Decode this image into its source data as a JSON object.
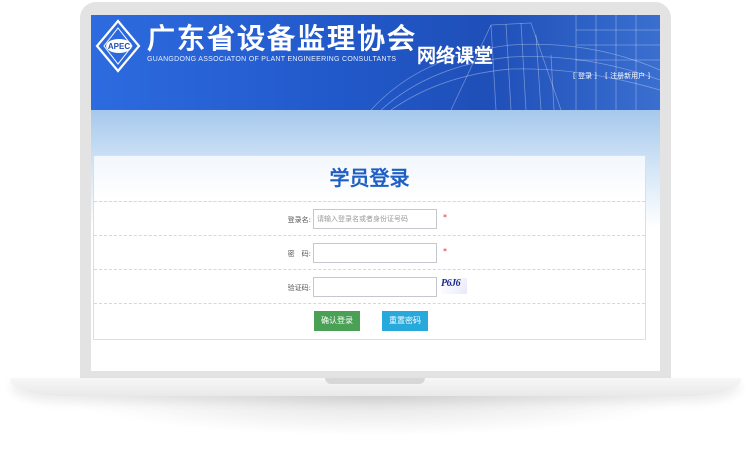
{
  "header": {
    "logo_text": "APEC",
    "org_name_cn": "广东省设备监理协会",
    "org_name_en": "GUANGDONG ASSOCIATON OF PLANT ENGINEERING CONSULTANTS",
    "classroom_label": "网络课堂",
    "links": {
      "login": "[ 登录 ]",
      "register": "[ 注册新用户 ]"
    }
  },
  "login_panel": {
    "title": "学员登录",
    "username": {
      "label": "登录名:",
      "placeholder": "请输入登录名或者身份证号码",
      "required_mark": "*"
    },
    "password": {
      "label": "密　码:",
      "required_mark": "*"
    },
    "captcha": {
      "label": "验证码:",
      "image_text": "P6J6"
    },
    "buttons": {
      "confirm": "确认登录",
      "reset": "重置密码"
    }
  },
  "colors": {
    "banner_blue": "#2158c9",
    "title_blue": "#1f5fc4",
    "confirm_green": "#4aa054",
    "reset_cyan": "#28a9dc",
    "required_red": "#e03030"
  }
}
